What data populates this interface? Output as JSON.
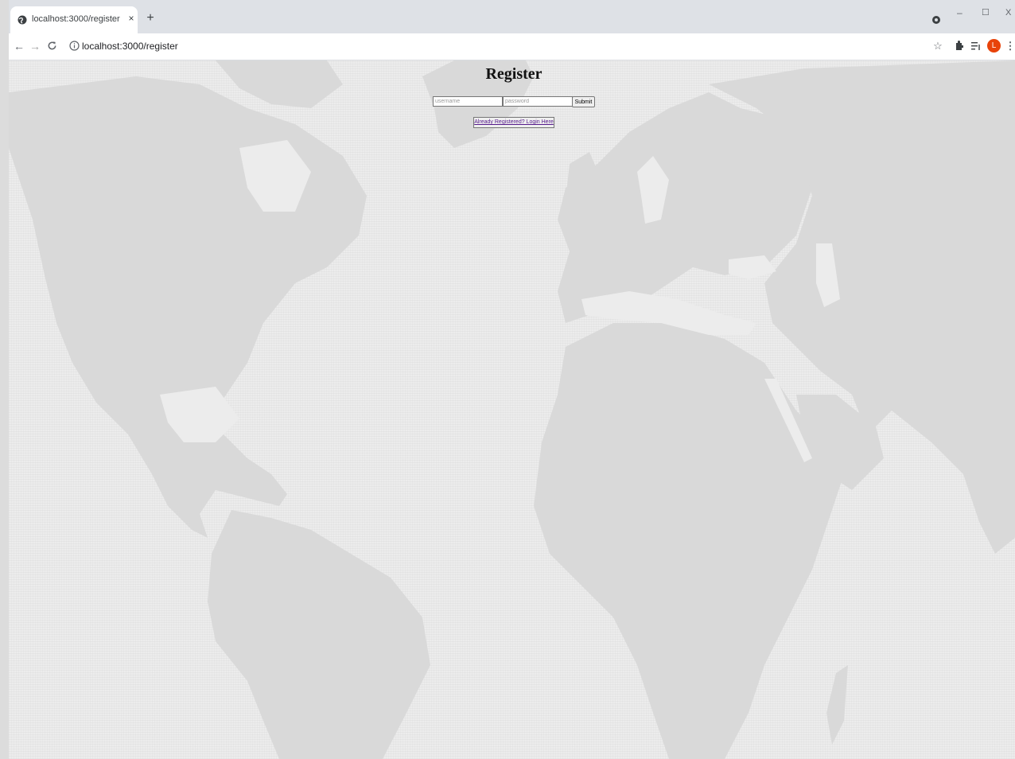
{
  "browser": {
    "tab_title": "localhost:3000/register",
    "tab_close": "×",
    "new_tab": "+",
    "url": "localhost:3000/register",
    "avatar_initial": "L",
    "controls": {
      "minimize": "–",
      "maximize": "☐",
      "close": "X"
    }
  },
  "page": {
    "title": "Register",
    "username_placeholder": "username",
    "password_placeholder": "password",
    "submit_label": "Submit",
    "login_link": "Already Registered? Login Here"
  },
  "colors": {
    "avatar": "#e8430a",
    "link": "#551a8b",
    "land": "#d9d9d9",
    "water": "#ececec"
  }
}
